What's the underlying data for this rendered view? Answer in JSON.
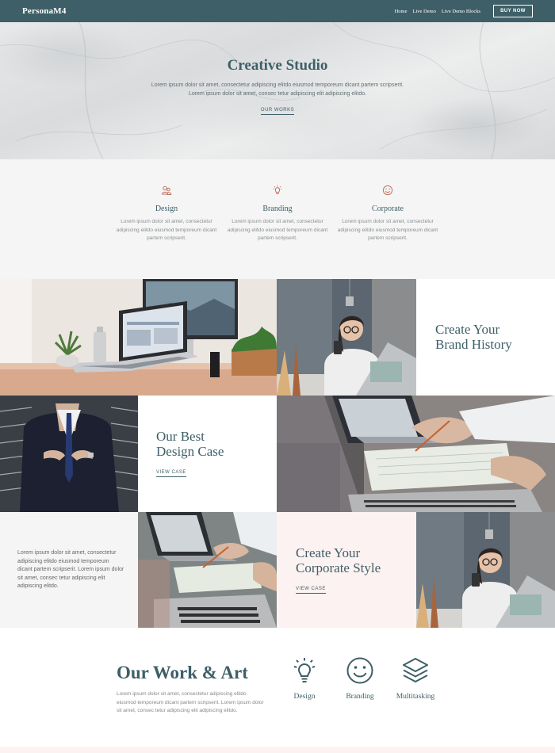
{
  "nav": {
    "brand": "PersonaM4",
    "links": [
      "Home",
      "Live Demo",
      "Live Demo Blocks"
    ],
    "cta": "BUY NOW"
  },
  "hero": {
    "title": "Creative Studio",
    "text": "Lorem ipsum dolor sit amet, consectetur adipiscing elitdo eiusmod temporeum dicant partem scripserit. Lorem ipsum dolor sit amet, consec tetur adipiscing elit adipiscing elitdo.",
    "link": "OUR WORKS"
  },
  "services": [
    {
      "icon": "people-icon",
      "title": "Design",
      "text": "Lorem ipsum dolor sit amet, consectetur adipiscing elitdo eiusmod temporeum dicant partem scripserit."
    },
    {
      "icon": "lightbulb-icon",
      "title": "Branding",
      "text": "Lorem ipsum dolor sit amet, consectetur adipiscing elitdo eiusmod temporeum dicant partem scripserit."
    },
    {
      "icon": "smiley-icon",
      "title": "Corporate",
      "text": "Lorem ipsum dolor sit amet, consectetur adipiscing elitdo eiusmod temporeum dicant partem scripserit."
    }
  ],
  "grid": {
    "brand_history": {
      "line1": "Create Your",
      "line2": "Brand History"
    },
    "best_case": {
      "line1": "Our Best",
      "line2": "Design Case",
      "link": "VIEW CASE"
    },
    "left_text": "Lorem ipsum dolor sit amet, consectetur adipiscing elitdo eiusmod temporeum dicant partem scripserit. Lorem ipsum dolor sit amet, consec tetur adipiscing elit adipiscing elitdo.",
    "corporate_style": {
      "line1": "Create Your",
      "line2": "Corporate Style",
      "link": "VIEW CASE"
    }
  },
  "art": {
    "title": "Our Work & Art",
    "text": "Lorem ipsum dolor sit amet, consectetur adipiscing elitdo eiusmod temporeum dicant partem scripserit. Lorem ipsum dolor sit amet, consec tetur adipiscing elit adipiscing elitdo.",
    "features": [
      {
        "icon": "lightbulb-icon",
        "label": "Design"
      },
      {
        "icon": "smiley-icon",
        "label": "Branding"
      },
      {
        "icon": "layers-icon",
        "label": "Multitasking"
      }
    ]
  },
  "colors": {
    "primary": "#3e5f67",
    "accent_icon": "#c0705e",
    "light_bg": "#f5f5f5",
    "pink_bg": "#fdf2f2"
  }
}
